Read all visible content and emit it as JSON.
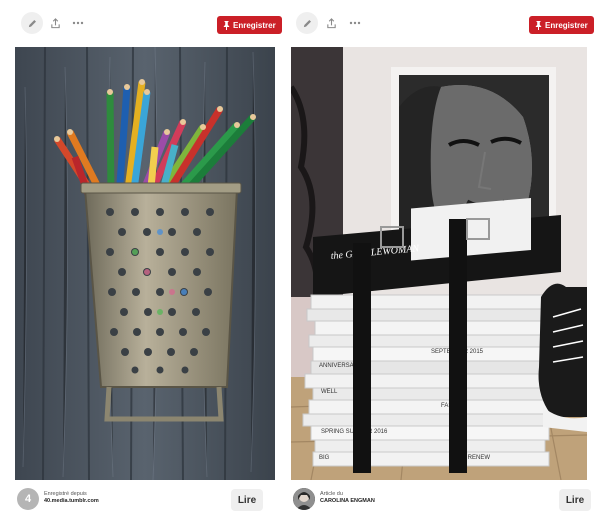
{
  "pins": [
    {
      "save_label": "Enregistrer",
      "avatar_text": "4",
      "meta_line1": "Enregistré depuis",
      "meta_line2": "40.media.tumblr.com",
      "read_label": "Lire",
      "icons": {
        "edit": "pencil-icon",
        "share": "share-icon",
        "more": "more-icon",
        "pin": "pushpin-icon"
      },
      "image_alt": "grater-pencil-holder-photo"
    },
    {
      "save_label": "Enregistrer",
      "meta_line1": "Article du",
      "meta_line2": "CAROLINA ENGMAN",
      "read_label": "Lire",
      "icons": {
        "edit": "pencil-icon",
        "share": "share-icon",
        "more": "more-icon",
        "pin": "pushpin-icon"
      },
      "image_alt": "book-stack-with-belts-photo",
      "book_cover_text": "the GENTLEWOMAN",
      "book_spine_labels": [
        "SEPTEMBER 2015",
        "ANNIVERSARY",
        "WELL",
        "FASHION",
        "SPRING SUMMER 2016",
        "BIG",
        "HIGH RENEW"
      ]
    }
  ],
  "colors": {
    "save": "#cb1f27",
    "button_gray": "#efefef",
    "avatar_gray": "#b5b5b5"
  }
}
